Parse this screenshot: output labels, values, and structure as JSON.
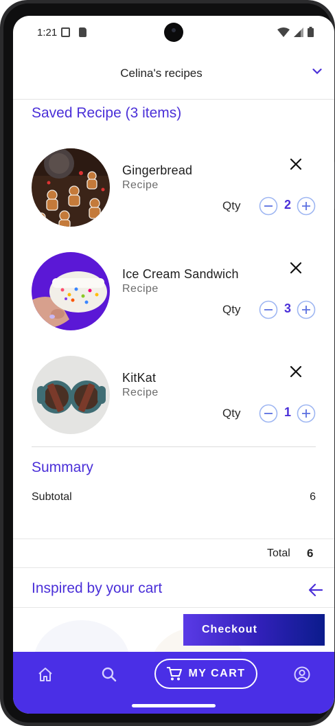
{
  "status_bar": {
    "time": "1:21"
  },
  "header": {
    "title": "Celina's recipes"
  },
  "saved": {
    "title": "Saved Recipe (3 items)",
    "items": [
      {
        "name": "Gingerbread",
        "type": "Recipe",
        "qty_label": "Qty",
        "qty": "2"
      },
      {
        "name": "Ice Cream Sandwich",
        "type": "Recipe",
        "qty_label": "Qty",
        "qty": "3"
      },
      {
        "name": "KitKat",
        "type": "Recipe",
        "qty_label": "Qty",
        "qty": "1"
      }
    ]
  },
  "summary": {
    "title": "Summary",
    "subtotal_label": "Subtotal",
    "subtotal_value": "6",
    "total_label": "Total",
    "total_value": "6"
  },
  "inspired": {
    "title": "Inspired by your cart"
  },
  "checkout": {
    "label": "Checkout"
  },
  "bottom_nav": {
    "cart_label": "MY CART"
  },
  "colors": {
    "accent": "#4a2fd8",
    "nav_bg": "#4a2fe6",
    "qty_border": "#9eb6f2"
  }
}
